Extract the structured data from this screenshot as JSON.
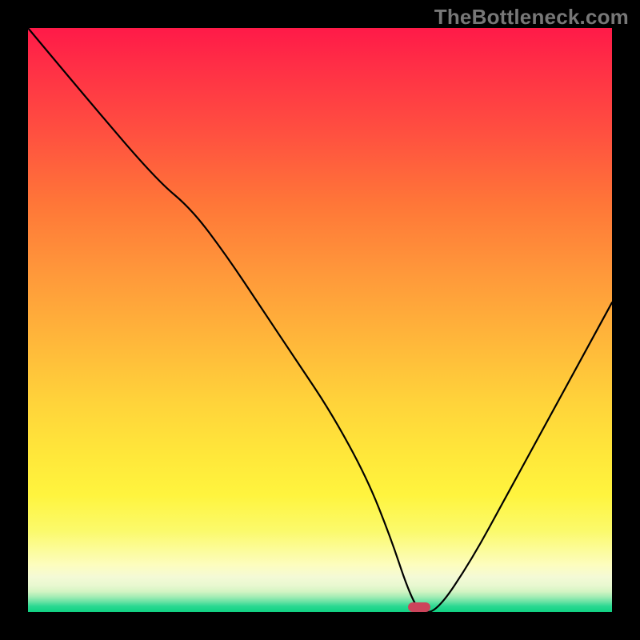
{
  "watermark": "TheBottleneck.com",
  "colors": {
    "frame": "#000000",
    "curve": "#000000",
    "marker": "#cc445b",
    "gradient_top": "#ff1a48",
    "gradient_bottom": "#0fd182"
  },
  "chart_data": {
    "type": "line",
    "title": "",
    "xlabel": "",
    "ylabel": "",
    "xlim": [
      0,
      100
    ],
    "ylim": [
      0,
      100
    ],
    "annotations": [
      {
        "type": "marker",
        "x": 67,
        "y": 0,
        "shape": "pill"
      }
    ],
    "series": [
      {
        "name": "bottleneck-curve",
        "x": [
          0,
          10,
          22,
          28,
          34,
          40,
          46,
          52,
          58,
          62,
          65,
          67,
          70,
          76,
          82,
          88,
          94,
          100
        ],
        "values": [
          100,
          88,
          74,
          69,
          61,
          52,
          43,
          34,
          23,
          13,
          4,
          0,
          0,
          9,
          20,
          31,
          42,
          53
        ]
      }
    ]
  }
}
